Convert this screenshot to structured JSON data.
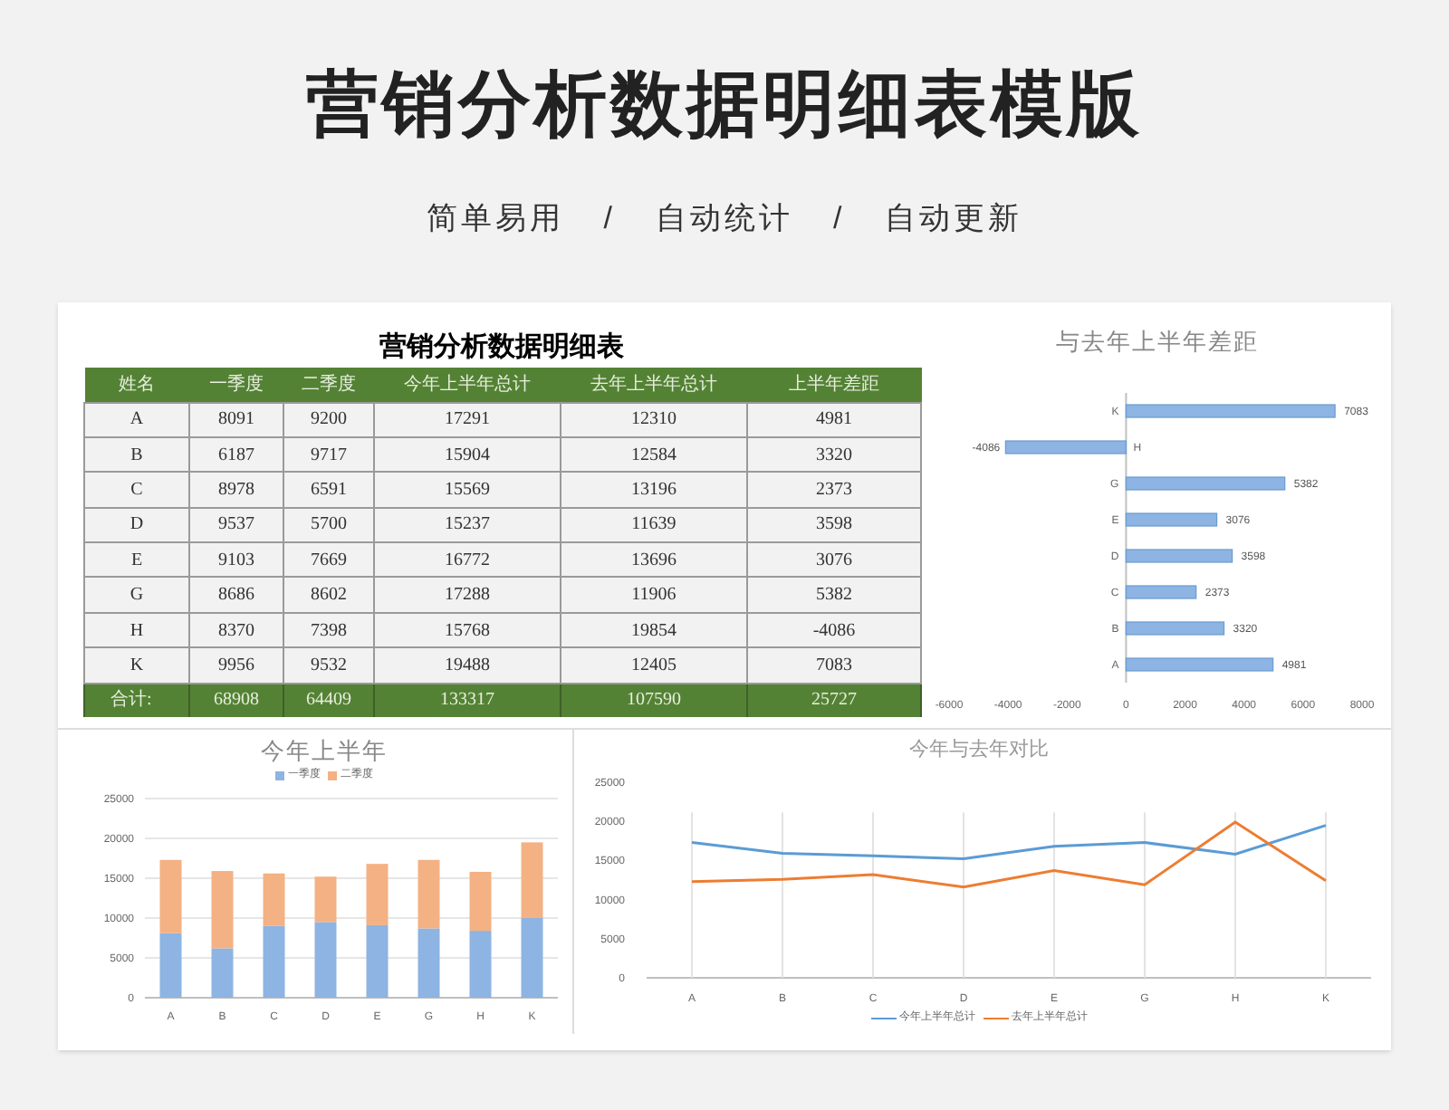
{
  "header": {
    "title": "营销分析数据明细表模版",
    "subtitle": [
      "简单易用",
      "自动统计",
      "自动更新"
    ],
    "separator": "/"
  },
  "table": {
    "title": "营销分析数据明细表",
    "columns": [
      "姓名",
      "一季度",
      "二季度",
      "今年上半年总计",
      "去年上半年总计",
      "上半年差距"
    ],
    "rows": [
      [
        "A",
        "8091",
        "9200",
        "17291",
        "12310",
        "4981"
      ],
      [
        "B",
        "6187",
        "9717",
        "15904",
        "12584",
        "3320"
      ],
      [
        "C",
        "8978",
        "6591",
        "15569",
        "13196",
        "2373"
      ],
      [
        "D",
        "9537",
        "5700",
        "15237",
        "11639",
        "3598"
      ],
      [
        "E",
        "9103",
        "7669",
        "16772",
        "13696",
        "3076"
      ],
      [
        "G",
        "8686",
        "8602",
        "17288",
        "11906",
        "5382"
      ],
      [
        "H",
        "8370",
        "7398",
        "15768",
        "19854",
        "-4086"
      ],
      [
        "K",
        "9956",
        "9532",
        "19488",
        "12405",
        "7083"
      ]
    ],
    "total": [
      "合计:",
      "68908",
      "64409",
      "133317",
      "107590",
      "25727"
    ]
  },
  "gap_chart": {
    "chart_data": {
      "type": "bar",
      "orientation": "horizontal",
      "title": "与去年上半年差距",
      "categories": [
        "K",
        "H",
        "G",
        "E",
        "D",
        "C",
        "B",
        "A"
      ],
      "series": [
        {
          "color": "#8db4e2",
          "values": [
            7083,
            -4086,
            5382,
            3076,
            3598,
            2373,
            3320,
            4981
          ]
        }
      ],
      "xlim": [
        -6000,
        8000
      ],
      "xticks": [
        -6000,
        -4000,
        -2000,
        0,
        2000,
        4000,
        6000,
        8000
      ],
      "data_labels": true
    }
  },
  "half_chart": {
    "chart_data": {
      "type": "bar",
      "stacked": true,
      "title": "今年上半年",
      "categories": [
        "A",
        "B",
        "C",
        "D",
        "E",
        "G",
        "H",
        "K"
      ],
      "series": [
        {
          "name": "一季度",
          "color": "#8db4e2",
          "values": [
            8100,
            6200,
            9000,
            9500,
            9100,
            8700,
            8400,
            10000
          ]
        },
        {
          "name": "二季度",
          "color": "#f4b183",
          "values": [
            9200,
            9700,
            6600,
            5700,
            7700,
            8600,
            7400,
            9500
          ]
        }
      ],
      "ylim": [
        0,
        25000
      ],
      "yticks": [
        0,
        5000,
        10000,
        15000,
        20000,
        25000
      ],
      "grid": true
    }
  },
  "compare_chart": {
    "chart_data": {
      "type": "line",
      "title": "今年与去年对比",
      "categories": [
        "A",
        "B",
        "C",
        "D",
        "E",
        "G",
        "H",
        "K"
      ],
      "series": [
        {
          "name": "今年上半年总计",
          "color": "#5b9bd5",
          "values": [
            17300,
            15900,
            15600,
            15200,
            16800,
            17300,
            15800,
            19500
          ]
        },
        {
          "name": "去年上半年总计",
          "color": "#ed7d31",
          "values": [
            12300,
            12600,
            13200,
            11600,
            13700,
            11900,
            19900,
            12400
          ]
        }
      ],
      "ylim": [
        0,
        25000
      ],
      "yticks": [
        0,
        5000,
        10000,
        15000,
        20000,
        25000
      ],
      "grid": true
    }
  }
}
